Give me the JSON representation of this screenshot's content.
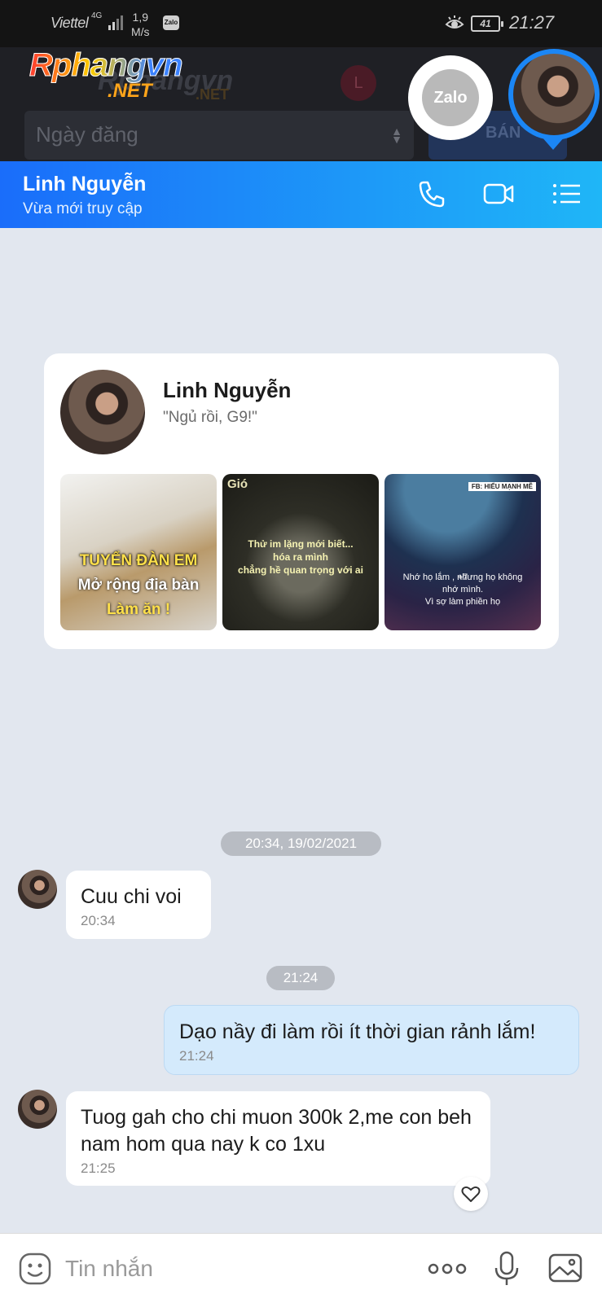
{
  "status_bar": {
    "carrier": "Viettel",
    "network": "4G",
    "speed_value": "1,9",
    "speed_unit": "M/s",
    "app_badge": "Zalo",
    "battery": "41",
    "time": "21:27"
  },
  "background_page": {
    "date_field_placeholder": "Ngày đăng",
    "ghost_avatar_letter": "L",
    "ghost_button": "BÁN"
  },
  "watermark": {
    "main": "Rphangvn",
    "suffix": ".NET"
  },
  "zalo_bubble_label": "Zalo",
  "header": {
    "name": "Linh Nguyễn",
    "status": "Vừa mới truy cập",
    "icons": [
      "phone-icon",
      "video-icon",
      "list-menu-icon"
    ],
    "accent_start": "#1a6dfa",
    "accent_end": "#1fb6f7"
  },
  "profile": {
    "name": "Linh Nguyễn",
    "status": "\"Ngủ rồi, G9!\"",
    "photos": [
      {
        "lines": [
          "TUYỂN ĐÀN EM",
          "Mở rộng địa bàn",
          "Làm ăn !"
        ]
      },
      {
        "tag": "Gió",
        "lines": [
          "Thử im lặng mới biết...",
          "hóa ra mình",
          "chẳng hề quan trọng với ai"
        ]
      },
      {
        "badge": "FB: HIỂU MẠNH MẼ",
        "more": "+7",
        "lines": [
          "Nhớ họ lắm , nhưng họ không",
          "nhớ mình.",
          "Vì sợ làm phiền họ"
        ]
      }
    ]
  },
  "timestamps": [
    "20:34, 19/02/2021",
    "21:24"
  ],
  "messages": [
    {
      "from": "them",
      "text": "Cuu chi voi",
      "time": "20:34"
    },
    {
      "from": "me",
      "text": "Dạo nầy đi làm rồi ít thời gian rảnh lắm!",
      "time": "21:24"
    },
    {
      "from": "them",
      "text": "Tuog gah cho chi muon 300k 2,me con beh nam hom qua nay k co 1xu",
      "time": "21:25"
    }
  ],
  "composer": {
    "placeholder": "Tin nhắn"
  }
}
